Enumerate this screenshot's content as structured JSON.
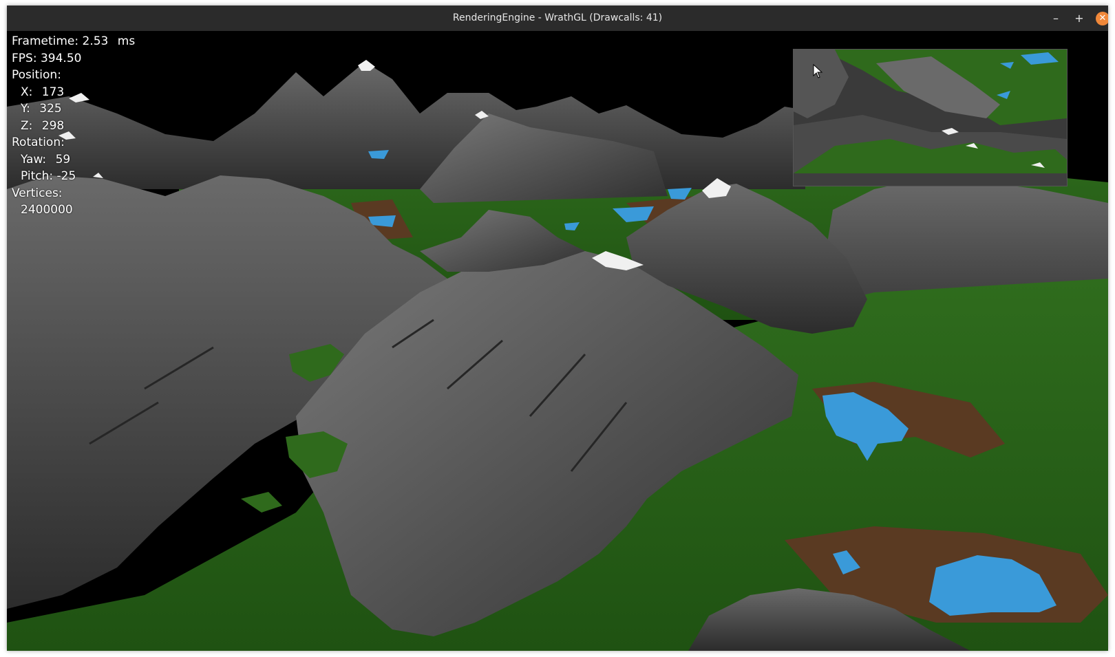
{
  "window": {
    "title": "RenderingEngine - WrathGL (Drawcalls: 41)",
    "buttons": {
      "minimize": "–",
      "maximize": "+",
      "close": "✕"
    }
  },
  "hud": {
    "frametime_label": "Frametime:",
    "frametime_value": "2.53",
    "frametime_unit": "ms",
    "fps_label": "FPS:",
    "fps_value": "394.50",
    "position_label": "Position:",
    "x_label": "X:",
    "x_value": "173",
    "y_label": "Y:",
    "y_value": "325",
    "z_label": "Z:",
    "z_value": "298",
    "rotation_label": "Rotation:",
    "yaw_label": "Yaw:",
    "yaw_value": "59",
    "pitch_label": "Pitch:",
    "pitch_value": "-25",
    "vertices_label": "Vertices:",
    "vertices_value": "2400000"
  },
  "colors": {
    "sky": "#000000",
    "rock": "#5a5a5a",
    "rock_dark": "#2e2e2e",
    "grass": "#2f6a1c",
    "grass_dark": "#1d4a10",
    "dirt": "#5a3a22",
    "water": "#3a9ad9",
    "snow": "#f0f0f0"
  },
  "icons": [
    "minimize-icon",
    "maximize-icon",
    "close-icon",
    "mouse-cursor-icon"
  ]
}
